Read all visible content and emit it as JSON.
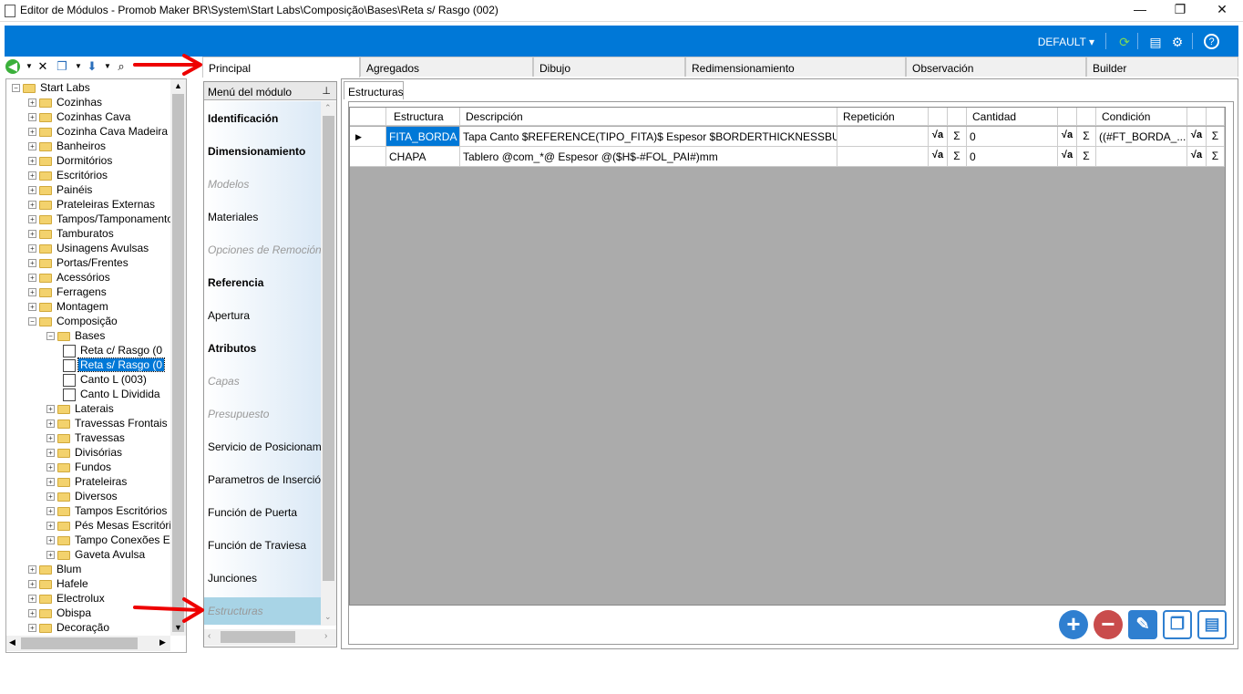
{
  "window": {
    "title": "Editor de Módulos - Promob Maker BR\\System\\Start Labs\\Composição\\Bases\\Reta s/ Rasgo (002)",
    "minimize": "—",
    "restore": "❐",
    "close": "✕"
  },
  "topbar": {
    "profile": "DEFAULT ▾",
    "icons": [
      "refresh-icon",
      "layout-icon",
      "settings-icon",
      "help-icon"
    ]
  },
  "tree": {
    "items": [
      {
        "label": "Start Labs",
        "level": 0,
        "expanded": true
      },
      {
        "label": "Cozinhas",
        "level": 1
      },
      {
        "label": "Cozinhas Cava",
        "level": 1
      },
      {
        "label": "Cozinha Cava Madeira",
        "level": 1
      },
      {
        "label": "Banheiros",
        "level": 1
      },
      {
        "label": "Dormitórios",
        "level": 1
      },
      {
        "label": "Escritórios",
        "level": 1
      },
      {
        "label": "Painéis",
        "level": 1
      },
      {
        "label": "Prateleiras Externas",
        "level": 1
      },
      {
        "label": "Tampos/Tamponamentos",
        "level": 1
      },
      {
        "label": "Tamburatos",
        "level": 1
      },
      {
        "label": "Usinagens Avulsas",
        "level": 1
      },
      {
        "label": "Portas/Frentes",
        "level": 1
      },
      {
        "label": "Acessórios",
        "level": 1
      },
      {
        "label": "Ferragens",
        "level": 1
      },
      {
        "label": "Montagem",
        "level": 1
      },
      {
        "label": "Composição",
        "level": 1,
        "expanded": true
      },
      {
        "label": "Bases",
        "level": 2,
        "expanded": true
      },
      {
        "label": "Reta c/ Rasgo (0",
        "level": 3,
        "doc": true
      },
      {
        "label": "Reta s/ Rasgo (0",
        "level": 3,
        "doc": true,
        "selected": true
      },
      {
        "label": "Canto L (003)",
        "level": 3,
        "doc": true
      },
      {
        "label": "Canto L Dividida",
        "level": 3,
        "doc": true
      },
      {
        "label": "Laterais",
        "level": 2
      },
      {
        "label": "Travessas Frontais",
        "level": 2
      },
      {
        "label": "Travessas",
        "level": 2
      },
      {
        "label": "Divisórias",
        "level": 2
      },
      {
        "label": "Fundos",
        "level": 2
      },
      {
        "label": "Prateleiras",
        "level": 2
      },
      {
        "label": "Diversos",
        "level": 2
      },
      {
        "label": "Tampos Escritórios",
        "level": 2
      },
      {
        "label": "Pés Mesas Escritórios",
        "level": 2
      },
      {
        "label": "Tampo Conexões Escr",
        "level": 2
      },
      {
        "label": "Gaveta Avulsa",
        "level": 2
      },
      {
        "label": "Blum",
        "level": 1
      },
      {
        "label": "Hafele",
        "level": 1
      },
      {
        "label": "Electrolux",
        "level": 1
      },
      {
        "label": "Obispa",
        "level": 1
      },
      {
        "label": "Decoração",
        "level": 1
      }
    ]
  },
  "tabs": [
    "Principal",
    "Agregados",
    "Dibujo",
    "Redimensionamiento",
    "Observación",
    "Builder"
  ],
  "menu": {
    "header": "Menú del módulo",
    "items": [
      {
        "label": "Identificación",
        "style": "bold"
      },
      {
        "label": "Dimensionamiento",
        "style": "bold"
      },
      {
        "label": "Modelos",
        "style": "dim"
      },
      {
        "label": "Materiales",
        "style": "normal"
      },
      {
        "label": "Opciones de Remoción",
        "style": "dim"
      },
      {
        "label": "Referencia",
        "style": "bold"
      },
      {
        "label": "Apertura",
        "style": "normal"
      },
      {
        "label": "Atributos",
        "style": "bold"
      },
      {
        "label": "Capas",
        "style": "dim"
      },
      {
        "label": "Presupuesto",
        "style": "dim"
      },
      {
        "label": "Servicio de Posicionamiento",
        "style": "normal"
      },
      {
        "label": "Parametros de Inserción",
        "style": "normal"
      },
      {
        "label": "Función de Puerta",
        "style": "normal"
      },
      {
        "label": "Función de Traviesa",
        "style": "normal"
      },
      {
        "label": "Junciones",
        "style": "normal"
      },
      {
        "label": "Estructuras",
        "style": "dim",
        "selected": true
      }
    ]
  },
  "structures": {
    "subtab": "Estructuras",
    "columns": [
      "Estructura",
      "Descripción",
      "Repetición",
      "Cantidad",
      "Condición"
    ],
    "sqrt_symbol": "√a",
    "sigma_symbol": "Σ",
    "rows": [
      {
        "estructura": "FITA_BORDA",
        "descripcion": "Tapa Canto $REFERENCE(TIPO_FITA)$ Espesor $BORDERTHICKNESSBUILDE...",
        "repeticion": "",
        "cantidad": "0",
        "condicion": "((#FT_BORDA_...",
        "current": true
      },
      {
        "estructura": "CHAPA",
        "descripcion": "Tablero @com_*@ Espesor @($H$-#FOL_PAI#)mm",
        "repeticion": "",
        "cantidad": "0",
        "condicion": "",
        "current": false
      }
    ],
    "row_marker": "▶"
  },
  "footer_buttons": [
    "add-icon",
    "remove-icon",
    "edit-icon",
    "copy-icon",
    "paste-icon"
  ]
}
